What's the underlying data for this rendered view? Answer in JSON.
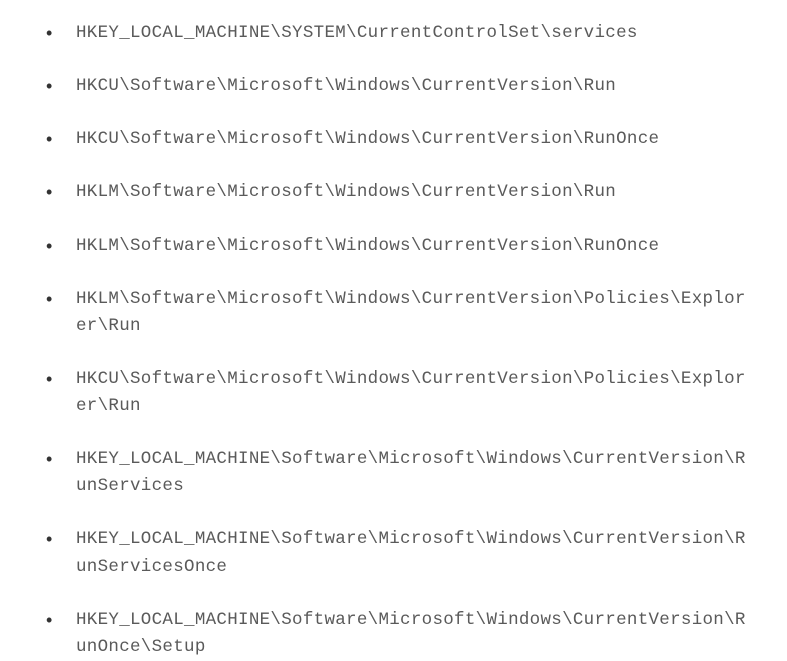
{
  "registry_paths": {
    "items": [
      "HKEY_LOCAL_MACHINE\\SYSTEM\\CurrentControlSet\\services",
      "HKCU\\Software\\Microsoft\\Windows\\CurrentVersion\\Run",
      "HKCU\\Software\\Microsoft\\Windows\\CurrentVersion\\RunOnce",
      "HKLM\\Software\\Microsoft\\Windows\\CurrentVersion\\Run",
      "HKLM\\Software\\Microsoft\\Windows\\CurrentVersion\\RunOnce",
      "HKLM\\Software\\Microsoft\\Windows\\CurrentVersion\\Policies\\Explorer\\Run",
      "HKCU\\Software\\Microsoft\\Windows\\CurrentVersion\\Policies\\Explorer\\Run",
      "HKEY_LOCAL_MACHINE\\Software\\Microsoft\\Windows\\CurrentVersion\\RunServices",
      "HKEY_LOCAL_MACHINE\\Software\\Microsoft\\Windows\\CurrentVersion\\RunServicesOnce",
      "HKEY_LOCAL_MACHINE\\Software\\Microsoft\\Windows\\CurrentVersion\\RunOnce\\Setup"
    ]
  }
}
